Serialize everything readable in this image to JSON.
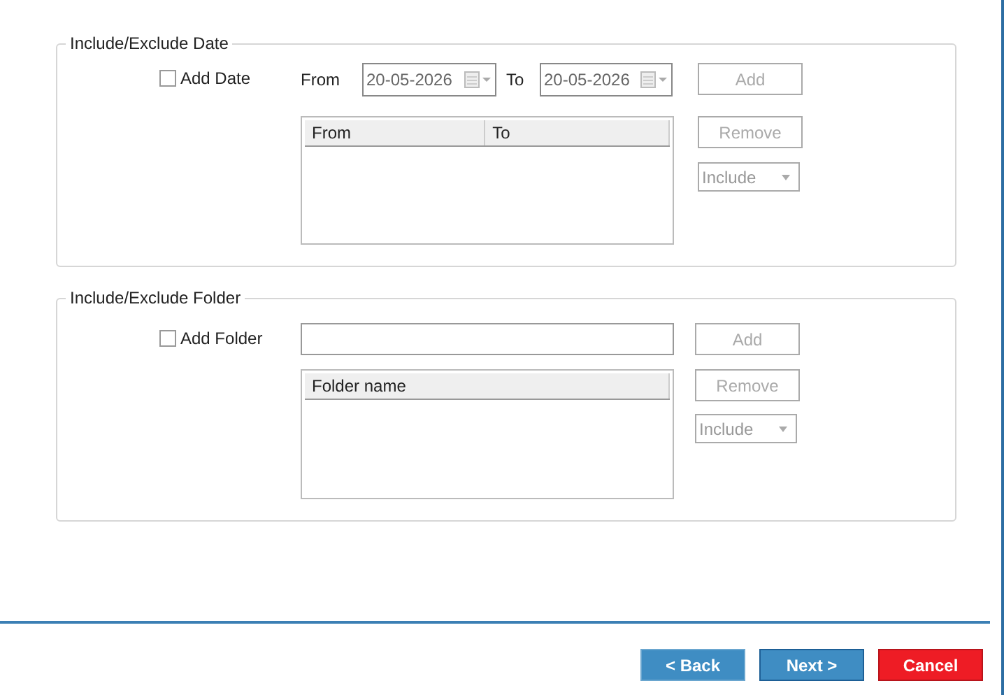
{
  "date_group": {
    "legend": "Include/Exclude Date",
    "checkbox": {
      "label": "Add Date",
      "checked": false
    },
    "from_label": "From",
    "from_value": "20-05-2026",
    "to_label": "To",
    "to_value": "20-05-2026",
    "add_button": {
      "label": "Add",
      "disabled": true
    },
    "list_columns": [
      "From",
      "To"
    ],
    "remove_button": {
      "label": "Remove",
      "disabled": true
    },
    "mode_dropdown": {
      "value": "Include",
      "disabled": true
    }
  },
  "folder_group": {
    "legend": "Include/Exclude Folder",
    "checkbox": {
      "label": "Add Folder",
      "checked": false
    },
    "add_button": {
      "label": "Add",
      "disabled": true
    },
    "list_columns": [
      "Folder name"
    ],
    "remove_button": {
      "label": "Remove",
      "disabled": true
    },
    "mode_dropdown": {
      "value": "Include",
      "disabled": true
    }
  },
  "nav_buttons": [
    {
      "label": "< Back",
      "kind": "secondary"
    },
    {
      "label": "Next >",
      "kind": "primary"
    },
    {
      "label": "Cancel",
      "kind": "danger"
    }
  ]
}
